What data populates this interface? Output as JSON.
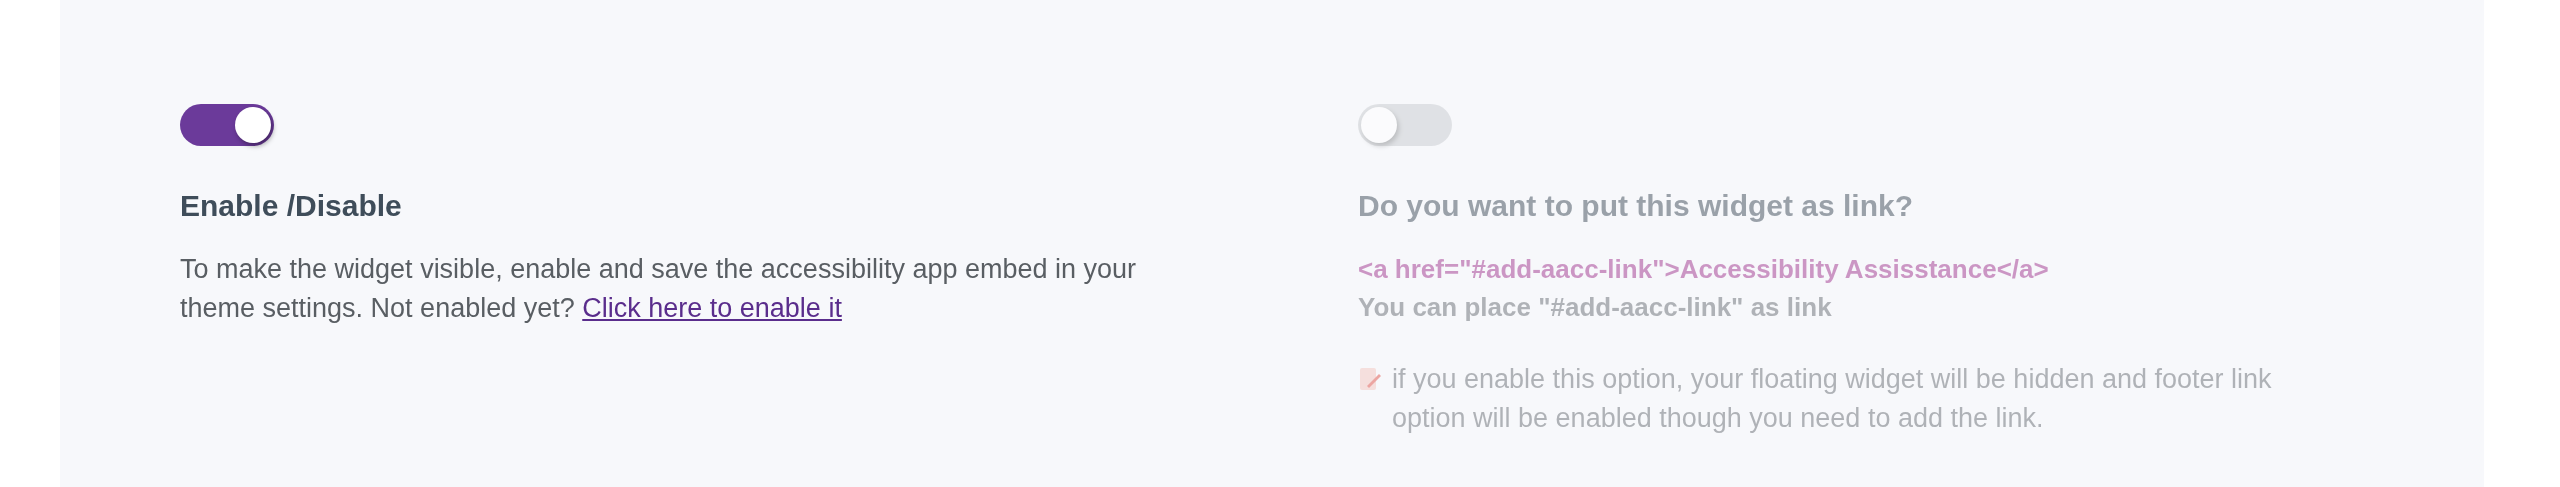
{
  "settings": [
    {
      "kind": "embed",
      "on": true,
      "disabled": false,
      "title": "Enable /Disable",
      "description": "To make the widget visible, enable and save the accessibility app embed in your theme settings. Not enabled yet?",
      "link": "Click here to enable it"
    },
    {
      "kind": "link-widget",
      "on": false,
      "disabled": true,
      "title": "Do you want to put this widget as link?",
      "code": "<a href=\"#add-aacc-link\">Accessibility Assisstance</a>",
      "hint": "You can place **\"#add-aacc-link\"** as link",
      "note": "if you enable this option, your floating widget will be hidden and footer link option will be enabled though you need to add the link."
    }
  ]
}
